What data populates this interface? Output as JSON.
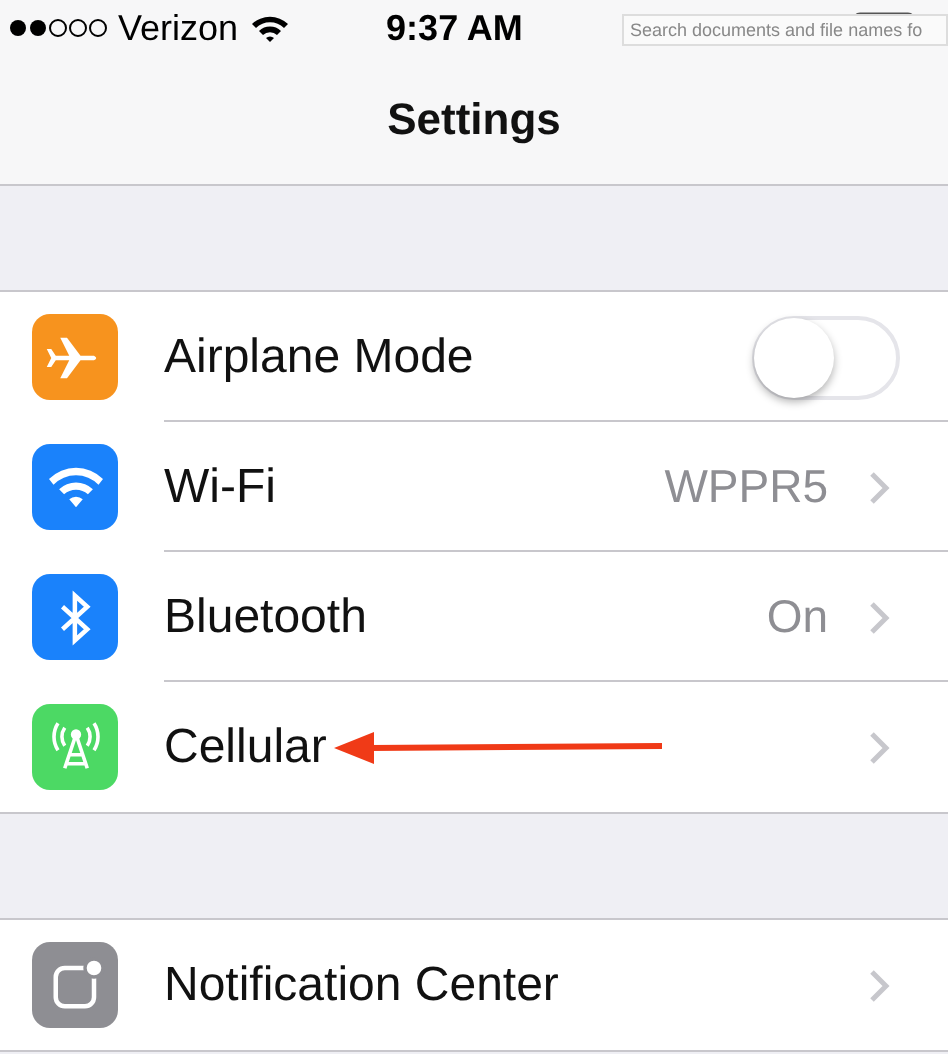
{
  "status_bar": {
    "carrier": "Verizon",
    "time": "9:37 AM"
  },
  "overlay_search": {
    "placeholder": "Search documents and file names fo"
  },
  "nav": {
    "title": "Settings"
  },
  "sections": [
    {
      "rows": [
        {
          "kind": "toggle",
          "color": "#f7931e",
          "label": "Airplane Mode",
          "on": false
        },
        {
          "kind": "disclosure",
          "color": "#1a82fb",
          "label": "Wi-Fi",
          "value": "WPPR5"
        },
        {
          "kind": "disclosure",
          "color": "#1a82fb",
          "label": "Bluetooth",
          "value": "On"
        },
        {
          "kind": "disclosure",
          "color": "#4cd964",
          "label": "Cellular",
          "annotated": true
        }
      ]
    },
    {
      "rows": [
        {
          "kind": "disclosure",
          "color": "#8e8e93",
          "label": "Notification Center"
        }
      ]
    }
  ]
}
